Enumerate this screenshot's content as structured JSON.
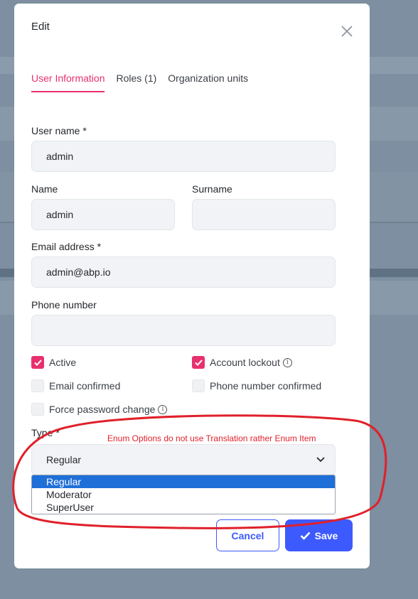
{
  "modal": {
    "title": "Edit",
    "tabs": [
      {
        "label": "User Information",
        "active": true
      },
      {
        "label": "Roles (1)",
        "active": false
      },
      {
        "label": "Organization units",
        "active": false
      }
    ]
  },
  "form": {
    "username": {
      "label": "User name *",
      "value": "admin"
    },
    "name": {
      "label": "Name",
      "value": "admin"
    },
    "surname": {
      "label": "Surname",
      "value": ""
    },
    "email": {
      "label": "Email address *",
      "value": "admin@abp.io"
    },
    "phone": {
      "label": "Phone number",
      "value": ""
    },
    "checkboxes": {
      "active": {
        "label": "Active",
        "checked": true
      },
      "account_lockout": {
        "label": "Account lockout",
        "checked": true
      },
      "email_confirmed": {
        "label": "Email confirmed",
        "checked": false
      },
      "phone_confirmed": {
        "label": "Phone number confirmed",
        "checked": false
      },
      "force_password_change": {
        "label": "Force password change",
        "checked": false
      }
    },
    "type": {
      "label": "Type *",
      "value": "Regular",
      "options": [
        "Regular",
        "Moderator",
        "SuperUser"
      ],
      "selected_option": "Regular"
    }
  },
  "buttons": {
    "cancel": "Cancel",
    "save": "Save"
  },
  "annotation": {
    "text": "Enum Options do not use Translation rather Enum Item",
    "color": "#e0202a"
  },
  "colors": {
    "accent": "#e8306e",
    "primary": "#3d5afe",
    "selection": "#1f6fd8"
  }
}
